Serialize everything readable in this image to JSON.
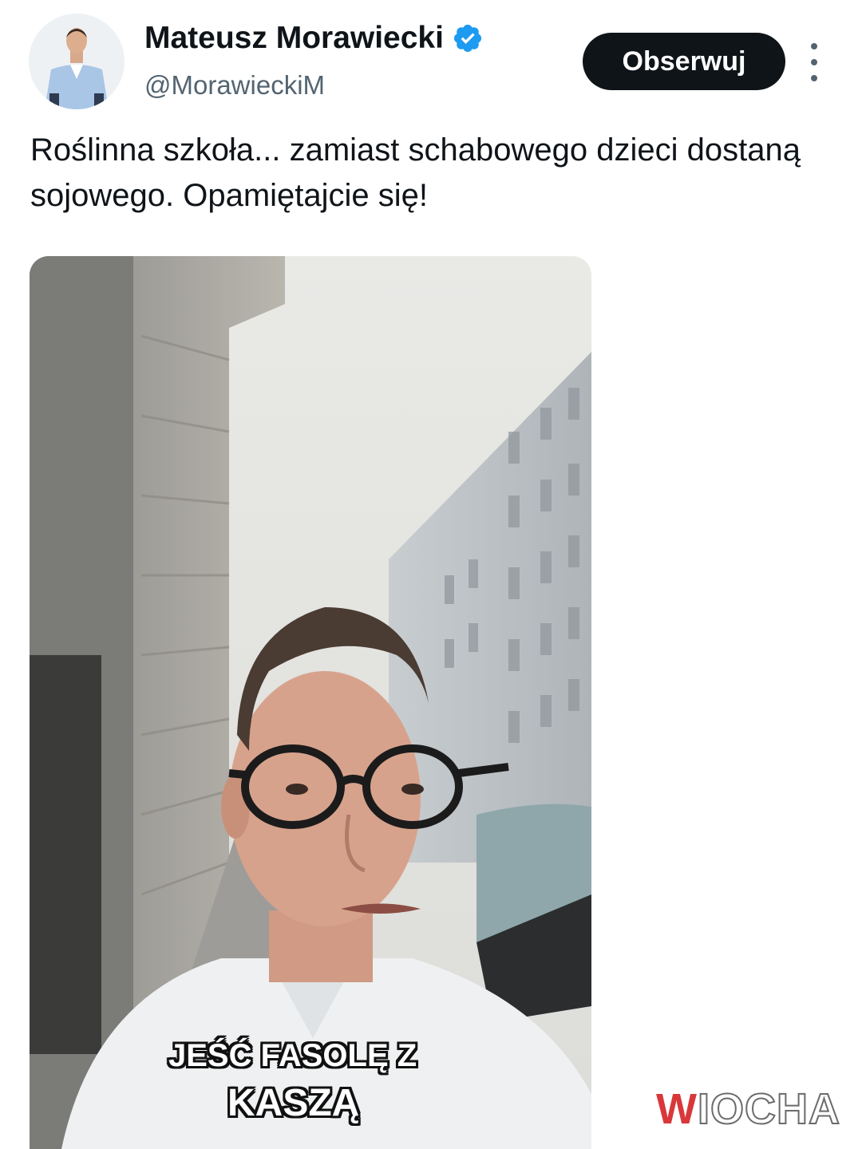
{
  "tweet": {
    "author": {
      "display_name": "Mateusz Morawiecki",
      "handle": "@MorawieckiM",
      "verified": true,
      "verified_color": "#1d9bf0"
    },
    "follow_label": "Obserwuj",
    "text": "Roślinna szkoła... zamiast schabowego dzieci dostaną sojowego. Opamiętajcie się!",
    "media": {
      "caption_line1": "JEŚĆ FASOLĘ Z",
      "caption_line2": "KASZĄ"
    }
  },
  "watermark": {
    "first_letter": "W",
    "rest": "IOCHA"
  }
}
